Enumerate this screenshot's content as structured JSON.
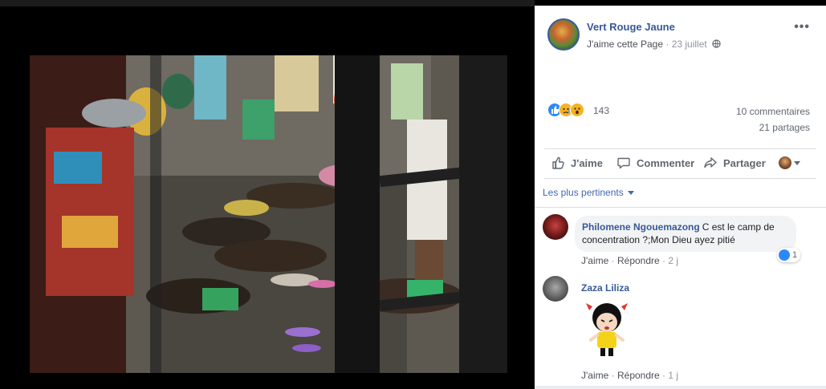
{
  "post": {
    "page_name": "Vert Rouge Jaune",
    "like_page": "J'aime cette Page",
    "separator": " · ",
    "date": "23 juillet",
    "privacy_icon": "globe-icon",
    "more_icon": "more-options-icon",
    "photo_subject": "photo"
  },
  "stats": {
    "reactions": [
      "like",
      "sad",
      "wow"
    ],
    "reaction_count": "143",
    "comments": "10 commentaires",
    "shares": "21 partages"
  },
  "actions": {
    "like": "J'aime",
    "comment": "Commenter",
    "share": "Partager"
  },
  "sort": {
    "label": "Les plus pertinents"
  },
  "comments": [
    {
      "author": "Philomene Ngouemazong",
      "text": "C est le camp de concentration ?;Mon Dieu ayez pitié",
      "like": "J'aime",
      "reply": "Répondre",
      "dot": " · ",
      "age": "2 j",
      "reaction_count": "1"
    },
    {
      "author": "Zaza Liliza",
      "sticker": "sticker-girl",
      "like": "J'aime",
      "reply": "Répondre",
      "dot": " · ",
      "age": "1 j"
    }
  ],
  "colors": {
    "brand": "#385898",
    "link": "#4267b2",
    "muted": "#90949c",
    "like_blue": "#2d88ff",
    "emoji_yellow": "#f7b125"
  }
}
